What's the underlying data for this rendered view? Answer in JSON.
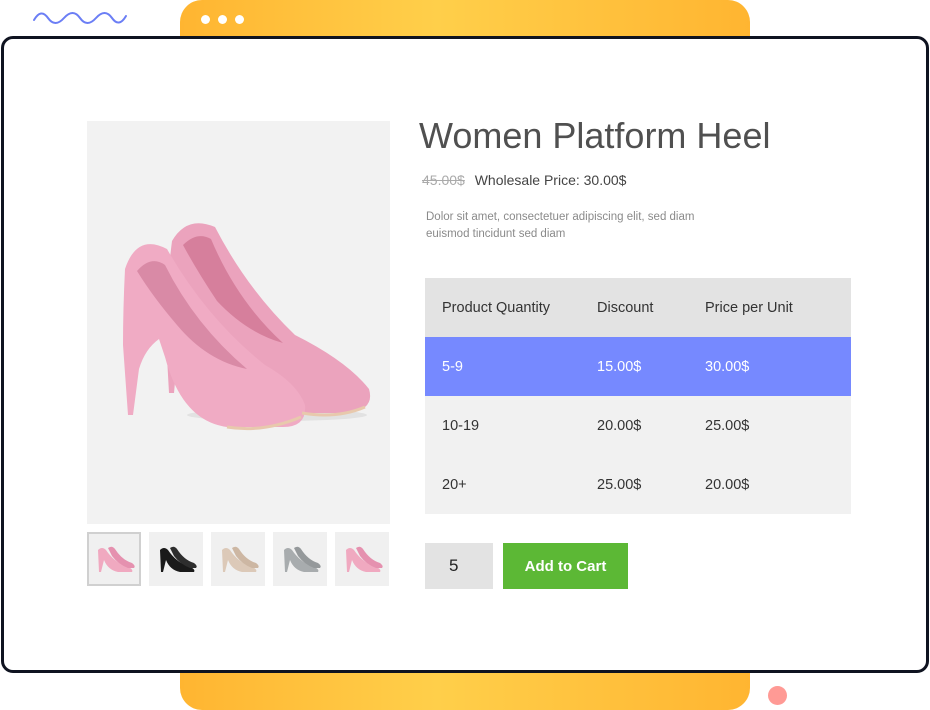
{
  "product": {
    "title": "Women Platform Heel",
    "old_price": "45.00$",
    "wholesale_price": "Wholesale Price: 30.00$",
    "description": "Dolor sit amet, consectetuer adipiscing elit, sed diam euismod tincidunt sed diam"
  },
  "gallery": {
    "thumbnails": [
      {
        "icon": "pink-heel-thumbnail",
        "color": "#f0a9c0",
        "selected": true
      },
      {
        "icon": "black-heel-thumbnail",
        "color": "#1a1a1a",
        "selected": false
      },
      {
        "icon": "beige-heel-thumbnail",
        "color": "#dcc9b8",
        "selected": false
      },
      {
        "icon": "silver-heel-thumbnail",
        "color": "#a8acae",
        "selected": false
      },
      {
        "icon": "pink-heel-thumbnail",
        "color": "#f0a9c0",
        "selected": false
      }
    ]
  },
  "pricing_table": {
    "headers": [
      "Product Quantity",
      "Discount",
      "Price per Unit"
    ],
    "rows": [
      {
        "quantity": "5-9",
        "discount": "15.00$",
        "price": "30.00$",
        "highlighted": true
      },
      {
        "quantity": "10-19",
        "discount": "20.00$",
        "price": "25.00$",
        "highlighted": false
      },
      {
        "quantity": "20+",
        "discount": "25.00$",
        "price": "20.00$",
        "highlighted": false
      }
    ]
  },
  "cart": {
    "quantity_value": "5",
    "add_to_cart_label": "Add to Cart"
  },
  "colors": {
    "accent_orange": "#ffb531",
    "highlight_blue": "#7689ff",
    "button_green": "#5cb835",
    "window_border": "#0f1320"
  }
}
